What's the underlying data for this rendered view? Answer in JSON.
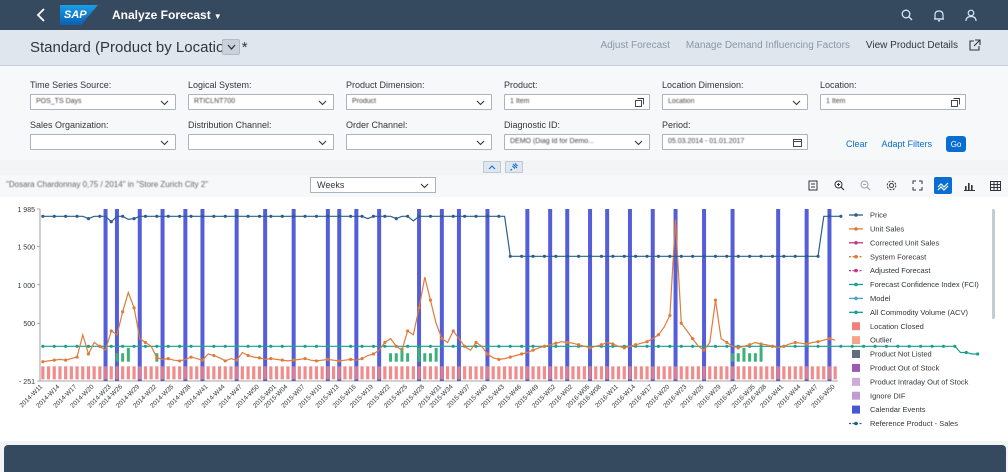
{
  "shell": {
    "app_title": "Analyze Forecast",
    "logo_text": "SAP",
    "icons": [
      "back-icon",
      "search-icon",
      "bell-icon",
      "user-icon"
    ]
  },
  "header": {
    "variant": "Standard (Product by Location) *",
    "actions": {
      "adjust": "Adjust Forecast",
      "manage": "Manage Demand Influencing Factors",
      "view": "View Product Details"
    }
  },
  "filters": {
    "time_series_source": {
      "label": "Time Series Source:",
      "value": "POS_TS Days"
    },
    "logical_system": {
      "label": "Logical System:",
      "value": "RTICLNT700"
    },
    "product_dimension": {
      "label": "Product Dimension:",
      "value": "Product"
    },
    "product": {
      "label": "Product:",
      "value": "1 Item"
    },
    "location_dimension": {
      "label": "Location Dimension:",
      "value": "Location"
    },
    "location": {
      "label": "Location:",
      "value": "1 Item"
    },
    "sales_organization": {
      "label": "Sales Organization:",
      "value": ""
    },
    "distribution_channel": {
      "label": "Distribution Channel:",
      "value": ""
    },
    "order_channel": {
      "label": "Order Channel:",
      "value": ""
    },
    "diagnostic_id": {
      "label": "Diagnostic ID:",
      "value": "DEMO (Diag Id for Demo..."
    },
    "period": {
      "label": "Period:",
      "value": "05.03.2014 - 01.01.2017"
    },
    "clear": "Clear",
    "adapt": "Adapt Filters",
    "go": "Go"
  },
  "chart_toolbar": {
    "title": "\"Dosara Chardonnay 0,75 / 2014\" in \"Store Zurich City 2\"",
    "period_granularity": "Weeks"
  },
  "chart_data": {
    "type": "line",
    "ylim": [
      -251,
      1985
    ],
    "yticks": [
      "1 985",
      "1 500",
      "1 000",
      "500",
      "- 251"
    ],
    "x_labels": [
      "2014-W11",
      "2014-W14",
      "2014-W17",
      "2014-W20",
      "2014-W23",
      "2014-W26",
      "2014-W29",
      "2014-W32",
      "2014-W35",
      "2014-W38",
      "2014-W41",
      "2014-W44",
      "2014-W47",
      "2014-W50",
      "2015-W01",
      "2015-W04",
      "2015-W07",
      "2015-W10",
      "2015-W13",
      "2015-W16",
      "2015-W19",
      "2015-W22",
      "2015-W25",
      "2015-W28",
      "2015-W31",
      "2015-W34",
      "2015-W37",
      "2015-W40",
      "2015-W43",
      "2015-W46",
      "2015-W49",
      "2015-W52",
      "2016-W02",
      "2016-W05",
      "2016-W08",
      "2016-W11",
      "2016-W14",
      "2016-W17",
      "2016-W20",
      "2016-W23",
      "2016-W26",
      "2016-W29",
      "2016-W32",
      "2016-W35",
      "2016-W38",
      "2016-W41",
      "2016-W44",
      "2016-W47",
      "2016-W50"
    ],
    "legend": [
      {
        "name": "Price",
        "color": "#2b5f8a",
        "kind": "line"
      },
      {
        "name": "Unit Sales",
        "color": "#e07b39",
        "kind": "line"
      },
      {
        "name": "Corrected Unit Sales",
        "color": "#c0398a",
        "kind": "line"
      },
      {
        "name": "System Forecast",
        "color": "#e07b39",
        "kind": "dash"
      },
      {
        "name": "Adjusted Forecast",
        "color": "#c0398a",
        "kind": "dash"
      },
      {
        "name": "Forecast Confidence Index (FCI)",
        "color": "#1a9e8f",
        "kind": "line"
      },
      {
        "name": "Model",
        "color": "#4aa3c9",
        "kind": "line"
      },
      {
        "name": "All Commodity Volume (ACV)",
        "color": "#1a9e8f",
        "kind": "line"
      },
      {
        "name": "Location Closed",
        "color": "#f08080",
        "kind": "box"
      },
      {
        "name": "Outlier",
        "color": "#f6a58a",
        "kind": "box"
      },
      {
        "name": "Product Not Listed",
        "color": "#5c6f7a",
        "kind": "box"
      },
      {
        "name": "Product Out of Stock",
        "color": "#9b59b6",
        "kind": "box"
      },
      {
        "name": "Product Intraday Out of Stock",
        "color": "#9b59b6",
        "kind": "hatch"
      },
      {
        "name": "Ignore DIF",
        "color": "#c39bd3",
        "kind": "box"
      },
      {
        "name": "Calendar Events",
        "color": "#4a55d6",
        "kind": "box"
      },
      {
        "name": "Reference Product - Sales",
        "color": "#2b5f8a",
        "kind": "dash"
      }
    ],
    "price": [
      1890,
      1890,
      1890,
      1890,
      1890,
      1890,
      1890,
      1890,
      1860,
      1890,
      1890,
      1890,
      1820,
      1890,
      1890,
      1850,
      1860,
      1890,
      1890,
      1890,
      1890,
      1890,
      1890,
      1890,
      1890,
      1890,
      1890,
      1890,
      1890,
      1890,
      1890,
      1890,
      1890,
      1890,
      1890,
      1890,
      1890,
      1890,
      1890,
      1890,
      1890,
      1890,
      1890,
      1890,
      1890,
      1890,
      1890,
      1890,
      1890,
      1890,
      1890,
      1890,
      1890,
      1890,
      1890,
      1890,
      1890,
      1860,
      1890,
      1890,
      1890,
      1890,
      1860,
      1890,
      1890,
      1830,
      1890,
      1890,
      1890,
      1890,
      1890,
      1890,
      1890,
      1890,
      1890,
      1890,
      1890,
      1890,
      1890,
      1890,
      1890,
      1890,
      1370,
      1370,
      1370,
      1370,
      1370,
      1370,
      1370,
      1370,
      1370,
      1370,
      1370,
      1370,
      1370,
      1370,
      1370,
      1370,
      1370,
      1370,
      1370,
      1370,
      1370,
      1370,
      1370,
      1370,
      1370,
      1370,
      1370,
      1370,
      1370,
      1370,
      1370,
      1370,
      1370,
      1370,
      1370,
      1370,
      1370,
      1370,
      1370,
      1370,
      1370,
      1370,
      1370,
      1370,
      1370,
      1370,
      1370,
      1370,
      1370,
      1370,
      1370,
      1370,
      1370,
      1370,
      1370,
      1890,
      1890,
      1890,
      1890
    ],
    "unit_sales": [
      0,
      10,
      20,
      30,
      20,
      40,
      60,
      350,
      100,
      250,
      200,
      150,
      400,
      350,
      650,
      900,
      700,
      300,
      250,
      200,
      50,
      30,
      40,
      20,
      10,
      30,
      60,
      40,
      20,
      100,
      80,
      50,
      10,
      40,
      20,
      120,
      80,
      60,
      50,
      30,
      40,
      30,
      20,
      10,
      20,
      30,
      40,
      20,
      10,
      20,
      30,
      20,
      10,
      20,
      30,
      20,
      40,
      80,
      100,
      150,
      250,
      300,
      200,
      150,
      400,
      350,
      700,
      1100,
      800,
      500,
      300,
      250,
      400,
      300,
      200,
      150,
      250,
      200,
      100,
      50,
      30,
      40,
      60,
      80,
      100,
      120,
      150,
      180,
      200,
      220,
      240,
      260,
      250,
      240,
      220,
      200,
      180,
      200,
      220,
      250,
      230,
      200,
      180,
      200,
      220,
      240,
      260,
      300,
      350,
      450,
      600,
      1850,
      500,
      400,
      300,
      200,
      150,
      250,
      800,
      300,
      250,
      200,
      180,
      200,
      220,
      250,
      230,
      220,
      200,
      180,
      200,
      230,
      250,
      240,
      230,
      250,
      260,
      280,
      300,
      280
    ],
    "fci": [
      200,
      200,
      200,
      200,
      200,
      200,
      200,
      200,
      200,
      200,
      200,
      200,
      200,
      200,
      200,
      200,
      200,
      200,
      200,
      200,
      200,
      200,
      200,
      200,
      200,
      200,
      200,
      200,
      200,
      200,
      200,
      200,
      200,
      200,
      200,
      200,
      200,
      200,
      200,
      200,
      200,
      200,
      200,
      200,
      200,
      200,
      200,
      200,
      200,
      200,
      200,
      200,
      200,
      200,
      200,
      200,
      200,
      200,
      200,
      200,
      200,
      200,
      200,
      200,
      200,
      200,
      200,
      200,
      200,
      200,
      200,
      200,
      200,
      200,
      200,
      200,
      200,
      200,
      200,
      200,
      200,
      200,
      200,
      200,
      200,
      200,
      200,
      200,
      200,
      200,
      200,
      200,
      200,
      200,
      200,
      200,
      200,
      200,
      200,
      200,
      200,
      200,
      200,
      200,
      200,
      200,
      200,
      200,
      200,
      200,
      200,
      200,
      200,
      200,
      200,
      200,
      200,
      200,
      200,
      200,
      200,
      200,
      200,
      200,
      200,
      200,
      200,
      200,
      200,
      200,
      200,
      200,
      200,
      200,
      200,
      200,
      200,
      200,
      200,
      200,
      200,
      200,
      200,
      200,
      200,
      200,
      200,
      200,
      200,
      200,
      200,
      200,
      200,
      200,
      200,
      200,
      200,
      200,
      200,
      200,
      200,
      120,
      120,
      100,
      100
    ],
    "calendar_event_weeks": [
      11,
      13,
      17,
      21,
      25,
      28,
      34,
      39,
      44,
      50,
      52,
      55,
      59,
      66,
      70,
      73,
      78,
      85,
      89,
      92,
      96,
      99,
      103,
      107,
      111,
      116,
      121,
      129,
      134,
      138
    ]
  }
}
